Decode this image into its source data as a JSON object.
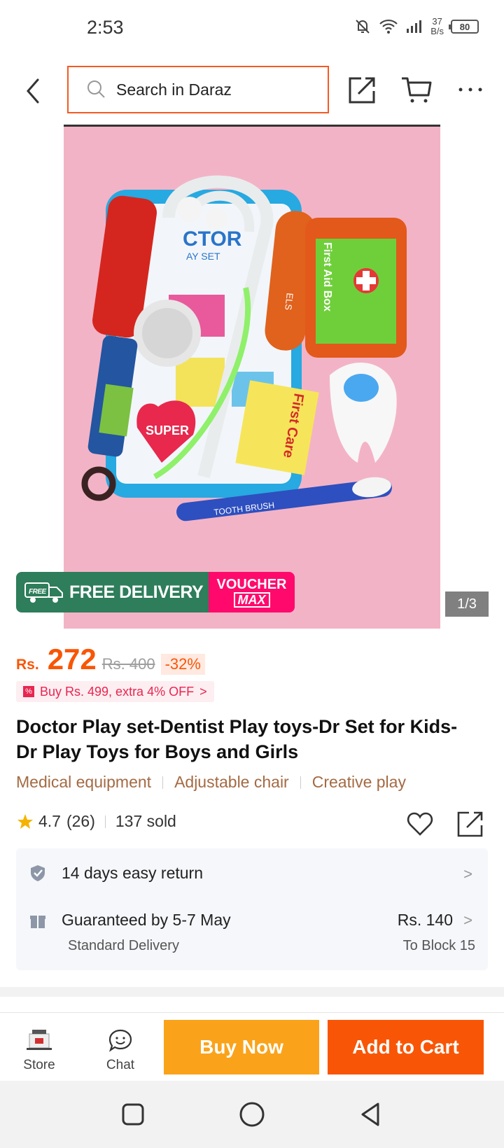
{
  "status_bar": {
    "time": "2:53",
    "net_speed_value": "37",
    "net_speed_unit": "B/s",
    "battery": "80"
  },
  "header": {
    "search_placeholder": "Search in Daraz"
  },
  "product_image": {
    "counter": "1/3",
    "promo_free_label": "FREE DELIVERY",
    "promo_free_badge": "FREE",
    "promo_voucher_top": "VOUCHER",
    "promo_voucher_bottom": "MAX",
    "toy_labels": {
      "doctor_mat": "CTOR",
      "doctor_mat_sub": "AY SET",
      "first_aid": "First Aid Box",
      "first_care": "First Care",
      "super": "SUPER",
      "toothbrush": "TOOTH BRUSH"
    }
  },
  "price": {
    "currency": "Rs.",
    "value": "272",
    "old": "Rs. 400",
    "discount": "-32%"
  },
  "offer": {
    "text": "Buy Rs. 499, extra 4% OFF",
    "chevron": ">"
  },
  "title": "Doctor Play set-Dentist Play toys-Dr Set for Kids- Dr Play Toys for Boys and Girls",
  "tags": [
    "Medical equipment",
    "Adjustable chair",
    "Creative play"
  ],
  "rating": {
    "score": "4.7",
    "count": "(26)",
    "sold": "137 sold"
  },
  "service": {
    "return_text": "14 days easy return",
    "delivery_text": "Guaranteed by 5-7 May",
    "delivery_sub": "Standard Delivery",
    "delivery_price": "Rs. 140",
    "delivery_location": "To Block 15",
    "chevron": ">"
  },
  "bottom_bar": {
    "store_label": "Store",
    "chat_label": "Chat",
    "buy_now_label": "Buy Now",
    "add_to_cart_label": "Add to Cart"
  },
  "colors": {
    "accent": "#f85606",
    "buy_now": "#faa31a",
    "search_border": "#f35a22",
    "tag_text": "#a46a43",
    "promo_green": "#2e7d5b",
    "promo_pink": "#ff0a6c"
  },
  "icons": [
    "back-arrow-icon",
    "search-icon",
    "share-icon",
    "cart-icon",
    "more-icon",
    "star-icon",
    "heart-icon",
    "shield-icon",
    "gift-icon",
    "store-icon",
    "chat-icon",
    "nav-square-icon",
    "nav-circle-icon",
    "nav-triangle-icon"
  ]
}
